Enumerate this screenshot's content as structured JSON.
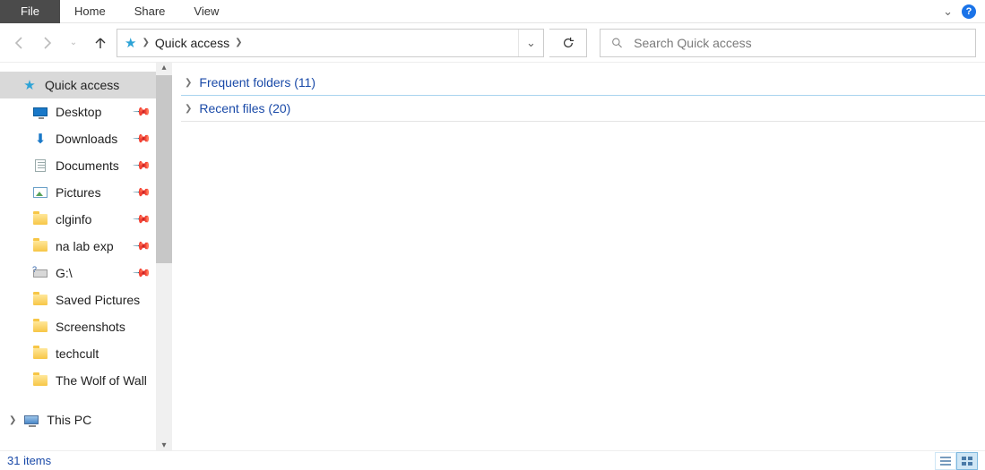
{
  "ribbon": {
    "file": "File",
    "tabs": [
      "Home",
      "Share",
      "View"
    ]
  },
  "nav": {
    "location": "Quick access"
  },
  "search": {
    "placeholder": "Search Quick access"
  },
  "sidebar": {
    "root": "Quick access",
    "items": [
      {
        "label": "Desktop",
        "icon": "monitor",
        "pinned": true
      },
      {
        "label": "Downloads",
        "icon": "download",
        "pinned": true
      },
      {
        "label": "Documents",
        "icon": "document",
        "pinned": true
      },
      {
        "label": "Pictures",
        "icon": "pictures",
        "pinned": true
      },
      {
        "label": "clginfo",
        "icon": "folder",
        "pinned": true
      },
      {
        "label": "na lab exp",
        "icon": "folder",
        "pinned": true
      },
      {
        "label": "G:\\",
        "icon": "drive",
        "pinned": true
      },
      {
        "label": "Saved Pictures",
        "icon": "folder",
        "pinned": false
      },
      {
        "label": "Screenshots",
        "icon": "folder",
        "pinned": false
      },
      {
        "label": "techcult",
        "icon": "folder",
        "pinned": false
      },
      {
        "label": "The Wolf of Wall",
        "icon": "folder",
        "pinned": false
      }
    ],
    "this_pc": "This PC"
  },
  "content": {
    "groups": [
      {
        "label": "Frequent folders (11)"
      },
      {
        "label": "Recent files (20)"
      }
    ]
  },
  "status": {
    "text": "31 items"
  }
}
